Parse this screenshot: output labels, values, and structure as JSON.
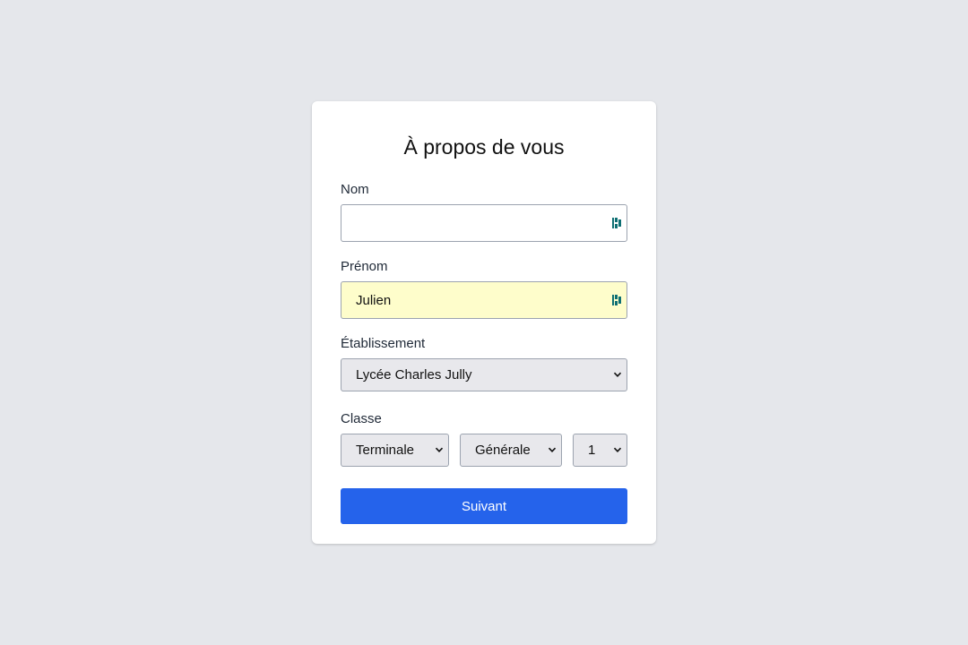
{
  "form": {
    "title": "À propos de vous",
    "nom": {
      "label": "Nom",
      "value": "",
      "placeholder": ""
    },
    "prenom": {
      "label": "Prénom",
      "value": "Julien",
      "placeholder": ""
    },
    "etablissement": {
      "label": "Établissement",
      "selected": "Lycée Charles Jully"
    },
    "classe": {
      "label": "Classe",
      "niveau": "Terminale",
      "voie": "Générale",
      "numero": "1"
    },
    "submit_label": "Suivant"
  },
  "colors": {
    "background": "#e5e7eb",
    "card": "#ffffff",
    "accent": "#2563eb",
    "autofill": "#fefdcb",
    "password_manager_icon": "#0e6f73"
  },
  "icons": {
    "field_icon": "password-manager-icon",
    "select_icon": "chevron-down-icon"
  }
}
